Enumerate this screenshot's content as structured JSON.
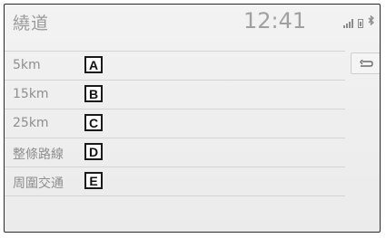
{
  "header": {
    "title": "繞道",
    "time": "12:41",
    "bluetooth_glyph": "ʙ"
  },
  "menu": {
    "items": [
      {
        "label": "5km",
        "marker": "A"
      },
      {
        "label": "15km",
        "marker": "B"
      },
      {
        "label": "25km",
        "marker": "C"
      },
      {
        "label": "整條路線",
        "marker": "D"
      },
      {
        "label": "周圍交通",
        "marker": "E"
      }
    ]
  },
  "icons": {
    "back": "back-arrow-icon",
    "signal": "signal-strength-icon",
    "battery": "battery-icon",
    "bluetooth": "bluetooth-icon"
  }
}
